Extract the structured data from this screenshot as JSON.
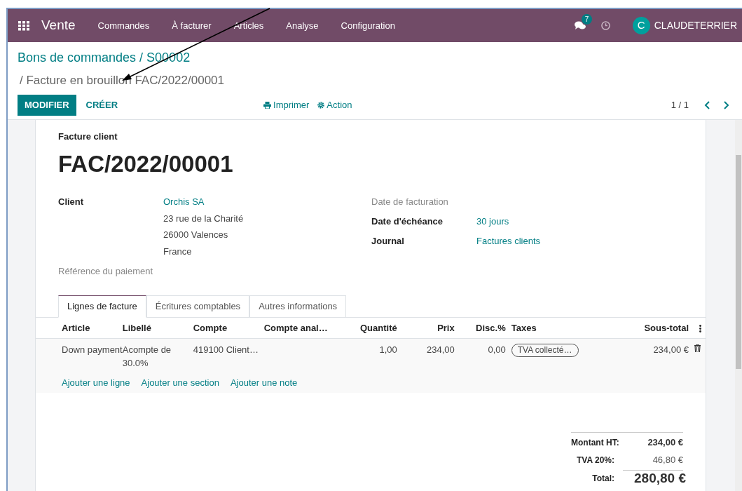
{
  "navbar": {
    "app": "Vente",
    "menu": [
      "Commandes",
      "À facturer",
      "Articles",
      "Analyse",
      "Configuration"
    ],
    "messages_count": "7",
    "user_initial": "C",
    "user": "CLAUDETERRIER"
  },
  "breadcrumb": {
    "parent": "Bons de commandes / S00002",
    "current": "/ Facture en brouillon FAC/2022/00001"
  },
  "buttons": {
    "edit": "MODIFIER",
    "create": "CRÉER",
    "print": "Imprimer",
    "action": "Action"
  },
  "pager": "1 / 1",
  "invoice": {
    "type": "Facture client",
    "number": "FAC/2022/00001",
    "left": [
      {
        "label": "Client",
        "lines": [
          "Orchis SA",
          "23 rue de la Charité",
          "26000 Valences",
          "France"
        ]
      }
    ],
    "payment_ref": "Référence du paiement",
    "right": [
      {
        "label": "Date de facturation",
        "muted": true
      },
      {
        "label": "Date d'échéance",
        "value": "30 jours",
        "muted": false
      },
      {
        "label": "Journal",
        "value": "Factures clients",
        "muted": false
      }
    ]
  },
  "tabs": [
    {
      "label": "Lignes de facture",
      "selected": true
    },
    {
      "label": "Écritures comptables",
      "selected": false
    },
    {
      "label": "Autres informations",
      "selected": false
    }
  ],
  "table": {
    "columns": [
      "Article",
      "Libellé",
      "Compte",
      "Compte anal…",
      "Quantité",
      "Prix",
      "Disc.%",
      "Taxes",
      "Sous-total"
    ],
    "rows": [
      {
        "article": "Down payment",
        "label": "Acompte de 30.0%",
        "account": "419100 Client…",
        "quantity": "1,00",
        "price": "234,00",
        "discount": "0,00",
        "tax": "TVA collecté…",
        "subtotal": "234,00 €"
      }
    ],
    "add_links": [
      "Ajouter une ligne",
      "Ajouter une section",
      "Ajouter une note"
    ]
  },
  "totals": [
    {
      "label": "Montant HT:",
      "value": "234,00 €",
      "kind": "bold"
    },
    {
      "label": "TVA 20%:",
      "value": "46,80 €",
      "kind": "plain"
    },
    {
      "label": "Total:",
      "value": "280,80 €",
      "kind": "total"
    }
  ]
}
